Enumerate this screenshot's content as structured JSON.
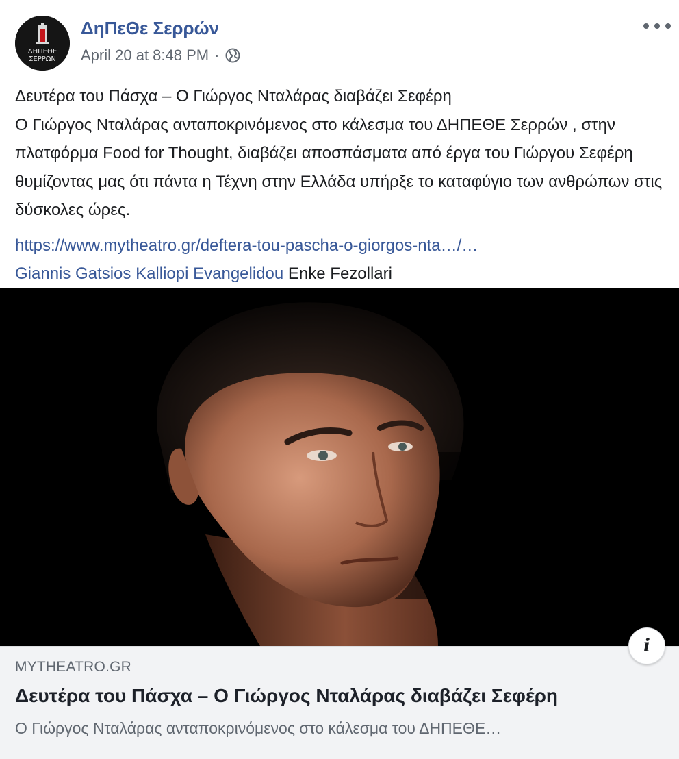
{
  "header": {
    "page_name": "ΔηΠεΘε Σερρών",
    "timestamp": "April 20 at 8:48 PM",
    "separator": "·",
    "privacy_icon": "globe-icon",
    "more_icon": "more-horizontal-icon",
    "avatar_text_line1": "ΔΗΠΕΘΕ",
    "avatar_text_line2": "ΣΕΡΡΩΝ"
  },
  "post": {
    "line1": "Δευτέρα του Πάσχα – Ο Γιώργος Νταλάρας διαβάζει Σεφέρη",
    "body": "Ο Γιώργος Νταλάρας ανταποκρινόμενος στο κάλεσμα του ΔΗΠΕΘΕ Σερρών , στην πλατφόρμα Food for Thought, διαβάζει αποσπάσματα από έργα του Γιώργου Σεφέρη θυμίζοντας μας ότι πάντα η Τέχνη στην Ελλάδα υπήρξε το καταφύγιο των ανθρώπων στις δύσκολες ώρες.",
    "url": "https://www.mytheatro.gr/deftera-tou-pascha-o-giorgos-nta…/…",
    "tags": [
      "Giannis Gatsios",
      "Kalliopi Evangelidou"
    ],
    "tag_plain": "Enke Fezollari"
  },
  "preview": {
    "domain": "MYTHEATRO.GR",
    "title": "Δευτέρα του Πάσχα – Ο Γιώργος Νταλάρας διαβάζει Σεφέρη",
    "description": "Ο Γιώργος Νταλάρας ανταποκρινόμενος στο κάλεσμα του ΔΗΠΕΘΕ…",
    "info_icon": "info-icon",
    "info_label": "i"
  },
  "colors": {
    "link": "#385898",
    "secondary_text": "#606770",
    "preview_bg": "#f2f3f5"
  }
}
